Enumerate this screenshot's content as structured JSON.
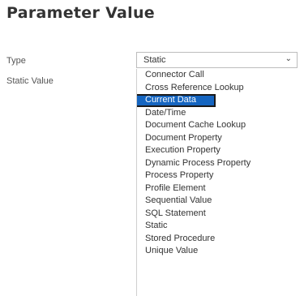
{
  "page": {
    "title": "Parameter Value"
  },
  "form": {
    "type_label": "Type",
    "static_value_label": "Static Value",
    "type_select": {
      "value": "Static",
      "chevron_icon": "chevron-down-icon"
    }
  },
  "dropdown": {
    "selected_index": 2,
    "options": [
      "Connector Call",
      "Cross Reference Lookup",
      "Current Data",
      "Date/Time",
      "Document Cache Lookup",
      "Document Property",
      "Execution Property",
      "Dynamic Process Property",
      "Process Property",
      "Profile Element",
      "Sequential Value",
      "SQL Statement",
      "Static",
      "Stored Procedure",
      "Unique Value"
    ]
  },
  "colors": {
    "highlight": "#1565c0",
    "highlight_border": "#1a1a1a"
  }
}
